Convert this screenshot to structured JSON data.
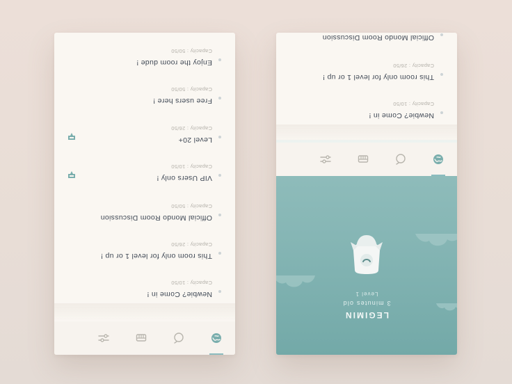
{
  "tabs": [
    {
      "icon": "globe-icon",
      "active": true
    },
    {
      "icon": "bubble-icon",
      "active": false
    },
    {
      "icon": "basket-icon",
      "active": false
    },
    {
      "icon": "sliders-icon",
      "active": false
    }
  ],
  "rooms_left": [
    {
      "name": "Newbie? Come in !",
      "capacity": "Capacity : 10/50",
      "badge": false
    },
    {
      "name": "This room only for level 1 or up !",
      "capacity": "Capacity : 26/50",
      "badge": false
    },
    {
      "name": "Official Mondo Room Discussion",
      "capacity": "Capacity : 50/50",
      "badge": false
    },
    {
      "name": "VIP Users only !",
      "capacity": "Capacity : 10/50",
      "badge": true
    },
    {
      "name": "Level 20+",
      "capacity": "Capacity : 26/50",
      "badge": true
    },
    {
      "name": "Free users here !",
      "capacity": "Capacity : 50/50",
      "badge": false
    },
    {
      "name": "Enjoy the room dude !",
      "capacity": "Capacity : 50/50",
      "badge": false
    }
  ],
  "rooms_right": [
    {
      "name": "Newbie? Come in !",
      "capacity": "Capacity : 10/50"
    },
    {
      "name": "This room only for level 1 or up !",
      "capacity": "Capacity : 26/50"
    },
    {
      "name": "Official Mondo Room Discussion",
      "capacity": ""
    }
  ],
  "profile": {
    "name": "LEGIMIN",
    "age": "3 minutes old",
    "level": "Level 1"
  },
  "colors": {
    "accent": "#8bbcbf",
    "sea": "#7aaead",
    "text": "#3e4754",
    "muted": "#b3b0a9",
    "background": "#faf7f2"
  }
}
